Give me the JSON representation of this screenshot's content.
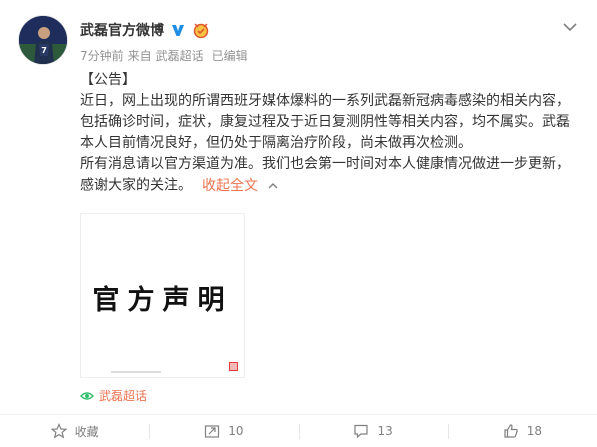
{
  "post": {
    "author": "武磊官方微博",
    "meta": {
      "time": "7分钟前",
      "source_prefix": "来自",
      "source": "武磊超话",
      "edited": "已编辑"
    },
    "text": {
      "tag": "【公告】",
      "para1": "近日，网上出现的所谓西班牙媒体爆料的一系列武磊新冠病毒感染的相关内容，包括确诊时间，症状，康复过程及于近日复测阴性等相关内容，均不属实。武磊本人目前情况良好，但仍处于隔离治疗阶段，尚未做再次检测。",
      "para2": "所有消息请以官方渠道为准。我们也会第一时间对本人健康情况做进一步更新，感谢大家的关注。",
      "collapse_label": "收起全文"
    },
    "image": {
      "text": "官方声明"
    },
    "topic_link": "武磊超话"
  },
  "actions": {
    "favorite_label": "收藏",
    "repost_count": "10",
    "comment_count": "13",
    "like_count": "18"
  },
  "colors": {
    "link": "#eb7350",
    "meta": "#939393",
    "text": "#333333"
  }
}
